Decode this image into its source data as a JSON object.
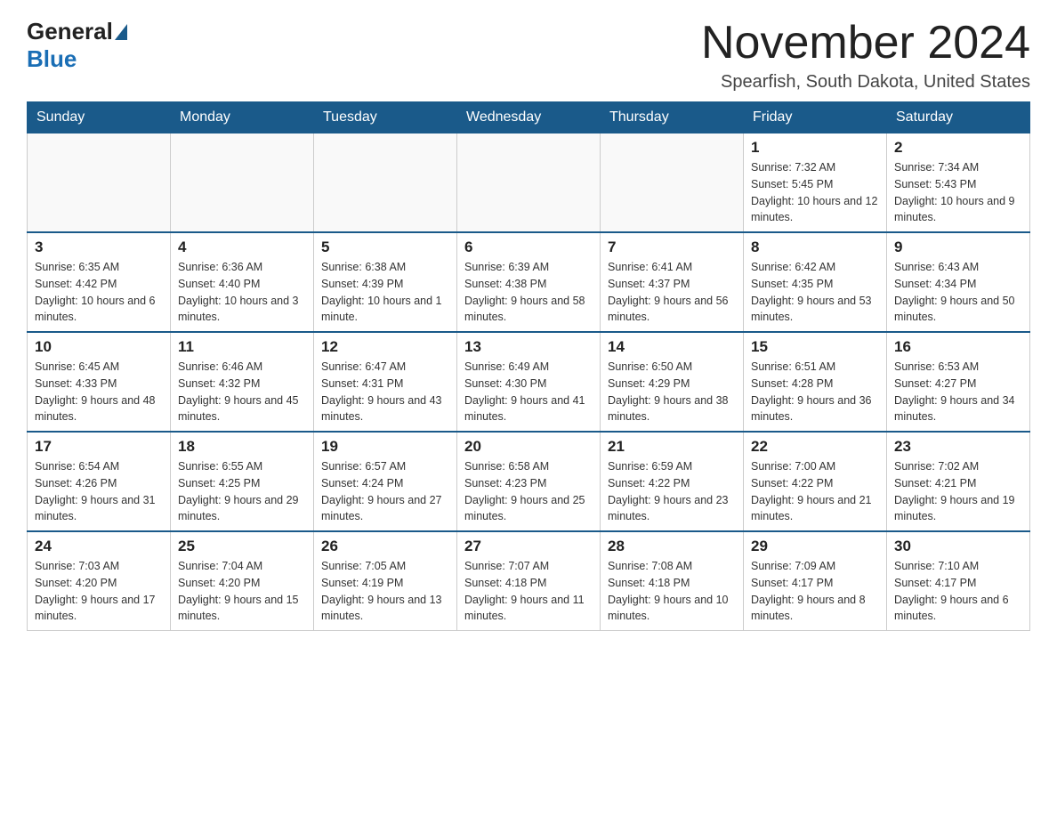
{
  "header": {
    "logo_general": "General",
    "logo_blue": "Blue",
    "month_title": "November 2024",
    "location": "Spearfish, South Dakota, United States"
  },
  "weekdays": [
    "Sunday",
    "Monday",
    "Tuesday",
    "Wednesday",
    "Thursday",
    "Friday",
    "Saturday"
  ],
  "weeks": [
    [
      {
        "day": "",
        "sunrise": "",
        "sunset": "",
        "daylight": ""
      },
      {
        "day": "",
        "sunrise": "",
        "sunset": "",
        "daylight": ""
      },
      {
        "day": "",
        "sunrise": "",
        "sunset": "",
        "daylight": ""
      },
      {
        "day": "",
        "sunrise": "",
        "sunset": "",
        "daylight": ""
      },
      {
        "day": "",
        "sunrise": "",
        "sunset": "",
        "daylight": ""
      },
      {
        "day": "1",
        "sunrise": "Sunrise: 7:32 AM",
        "sunset": "Sunset: 5:45 PM",
        "daylight": "Daylight: 10 hours and 12 minutes."
      },
      {
        "day": "2",
        "sunrise": "Sunrise: 7:34 AM",
        "sunset": "Sunset: 5:43 PM",
        "daylight": "Daylight: 10 hours and 9 minutes."
      }
    ],
    [
      {
        "day": "3",
        "sunrise": "Sunrise: 6:35 AM",
        "sunset": "Sunset: 4:42 PM",
        "daylight": "Daylight: 10 hours and 6 minutes."
      },
      {
        "day": "4",
        "sunrise": "Sunrise: 6:36 AM",
        "sunset": "Sunset: 4:40 PM",
        "daylight": "Daylight: 10 hours and 3 minutes."
      },
      {
        "day": "5",
        "sunrise": "Sunrise: 6:38 AM",
        "sunset": "Sunset: 4:39 PM",
        "daylight": "Daylight: 10 hours and 1 minute."
      },
      {
        "day": "6",
        "sunrise": "Sunrise: 6:39 AM",
        "sunset": "Sunset: 4:38 PM",
        "daylight": "Daylight: 9 hours and 58 minutes."
      },
      {
        "day": "7",
        "sunrise": "Sunrise: 6:41 AM",
        "sunset": "Sunset: 4:37 PM",
        "daylight": "Daylight: 9 hours and 56 minutes."
      },
      {
        "day": "8",
        "sunrise": "Sunrise: 6:42 AM",
        "sunset": "Sunset: 4:35 PM",
        "daylight": "Daylight: 9 hours and 53 minutes."
      },
      {
        "day": "9",
        "sunrise": "Sunrise: 6:43 AM",
        "sunset": "Sunset: 4:34 PM",
        "daylight": "Daylight: 9 hours and 50 minutes."
      }
    ],
    [
      {
        "day": "10",
        "sunrise": "Sunrise: 6:45 AM",
        "sunset": "Sunset: 4:33 PM",
        "daylight": "Daylight: 9 hours and 48 minutes."
      },
      {
        "day": "11",
        "sunrise": "Sunrise: 6:46 AM",
        "sunset": "Sunset: 4:32 PM",
        "daylight": "Daylight: 9 hours and 45 minutes."
      },
      {
        "day": "12",
        "sunrise": "Sunrise: 6:47 AM",
        "sunset": "Sunset: 4:31 PM",
        "daylight": "Daylight: 9 hours and 43 minutes."
      },
      {
        "day": "13",
        "sunrise": "Sunrise: 6:49 AM",
        "sunset": "Sunset: 4:30 PM",
        "daylight": "Daylight: 9 hours and 41 minutes."
      },
      {
        "day": "14",
        "sunrise": "Sunrise: 6:50 AM",
        "sunset": "Sunset: 4:29 PM",
        "daylight": "Daylight: 9 hours and 38 minutes."
      },
      {
        "day": "15",
        "sunrise": "Sunrise: 6:51 AM",
        "sunset": "Sunset: 4:28 PM",
        "daylight": "Daylight: 9 hours and 36 minutes."
      },
      {
        "day": "16",
        "sunrise": "Sunrise: 6:53 AM",
        "sunset": "Sunset: 4:27 PM",
        "daylight": "Daylight: 9 hours and 34 minutes."
      }
    ],
    [
      {
        "day": "17",
        "sunrise": "Sunrise: 6:54 AM",
        "sunset": "Sunset: 4:26 PM",
        "daylight": "Daylight: 9 hours and 31 minutes."
      },
      {
        "day": "18",
        "sunrise": "Sunrise: 6:55 AM",
        "sunset": "Sunset: 4:25 PM",
        "daylight": "Daylight: 9 hours and 29 minutes."
      },
      {
        "day": "19",
        "sunrise": "Sunrise: 6:57 AM",
        "sunset": "Sunset: 4:24 PM",
        "daylight": "Daylight: 9 hours and 27 minutes."
      },
      {
        "day": "20",
        "sunrise": "Sunrise: 6:58 AM",
        "sunset": "Sunset: 4:23 PM",
        "daylight": "Daylight: 9 hours and 25 minutes."
      },
      {
        "day": "21",
        "sunrise": "Sunrise: 6:59 AM",
        "sunset": "Sunset: 4:22 PM",
        "daylight": "Daylight: 9 hours and 23 minutes."
      },
      {
        "day": "22",
        "sunrise": "Sunrise: 7:00 AM",
        "sunset": "Sunset: 4:22 PM",
        "daylight": "Daylight: 9 hours and 21 minutes."
      },
      {
        "day": "23",
        "sunrise": "Sunrise: 7:02 AM",
        "sunset": "Sunset: 4:21 PM",
        "daylight": "Daylight: 9 hours and 19 minutes."
      }
    ],
    [
      {
        "day": "24",
        "sunrise": "Sunrise: 7:03 AM",
        "sunset": "Sunset: 4:20 PM",
        "daylight": "Daylight: 9 hours and 17 minutes."
      },
      {
        "day": "25",
        "sunrise": "Sunrise: 7:04 AM",
        "sunset": "Sunset: 4:20 PM",
        "daylight": "Daylight: 9 hours and 15 minutes."
      },
      {
        "day": "26",
        "sunrise": "Sunrise: 7:05 AM",
        "sunset": "Sunset: 4:19 PM",
        "daylight": "Daylight: 9 hours and 13 minutes."
      },
      {
        "day": "27",
        "sunrise": "Sunrise: 7:07 AM",
        "sunset": "Sunset: 4:18 PM",
        "daylight": "Daylight: 9 hours and 11 minutes."
      },
      {
        "day": "28",
        "sunrise": "Sunrise: 7:08 AM",
        "sunset": "Sunset: 4:18 PM",
        "daylight": "Daylight: 9 hours and 10 minutes."
      },
      {
        "day": "29",
        "sunrise": "Sunrise: 7:09 AM",
        "sunset": "Sunset: 4:17 PM",
        "daylight": "Daylight: 9 hours and 8 minutes."
      },
      {
        "day": "30",
        "sunrise": "Sunrise: 7:10 AM",
        "sunset": "Sunset: 4:17 PM",
        "daylight": "Daylight: 9 hours and 6 minutes."
      }
    ]
  ]
}
